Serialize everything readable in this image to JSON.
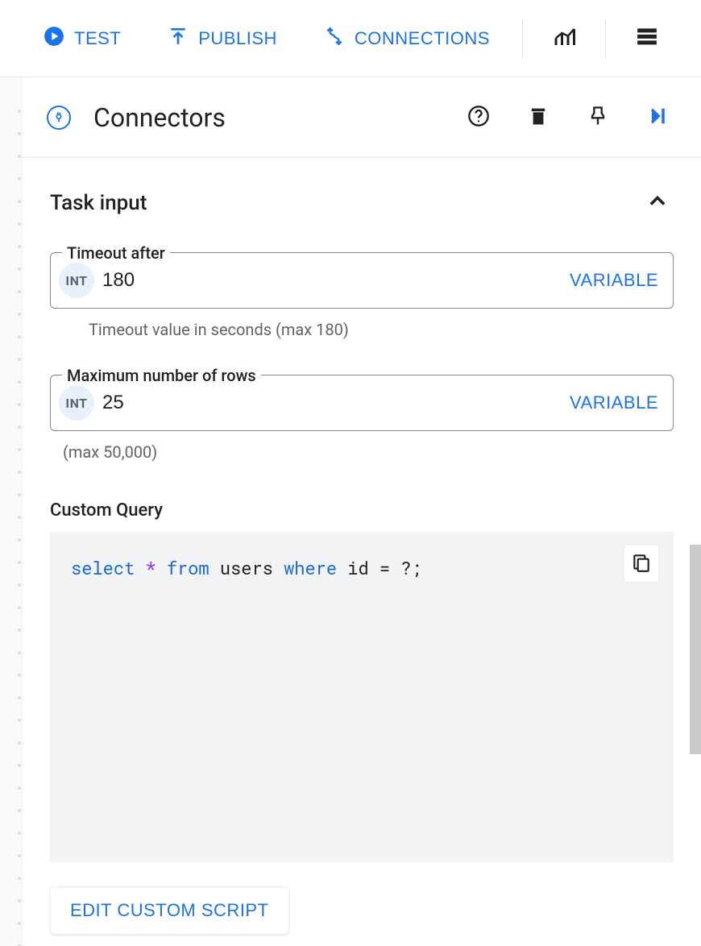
{
  "toolbar": {
    "test_label": "TEST",
    "publish_label": "PUBLISH",
    "connections_label": "CONNECTIONS"
  },
  "panel": {
    "title": "Connectors"
  },
  "section": {
    "title": "Task input"
  },
  "fields": {
    "timeout": {
      "label": "Timeout after",
      "chip": "INT",
      "value": "180",
      "variable_label": "VARIABLE",
      "helper": "Timeout value in seconds (max 180)"
    },
    "max_rows": {
      "label": "Maximum number of rows",
      "chip": "INT",
      "value": "25",
      "variable_label": "VARIABLE",
      "helper": "(max 50,000)"
    }
  },
  "custom_query": {
    "label": "Custom Query",
    "tokens": {
      "t1": "select",
      "t2": "*",
      "t3": "from",
      "t4": "users",
      "t5": "where",
      "t6": "id = ?;"
    }
  },
  "edit_script_label": "EDIT CUSTOM SCRIPT"
}
